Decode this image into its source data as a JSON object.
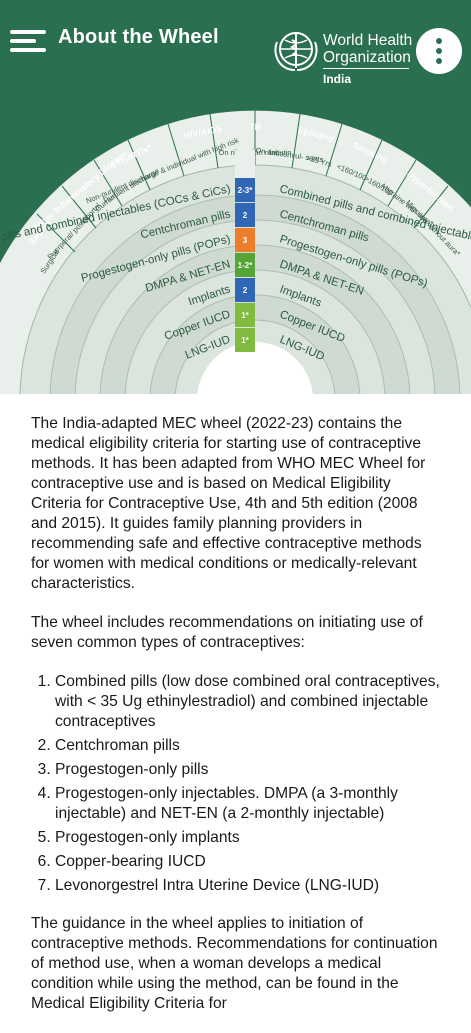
{
  "header": {
    "title": "About the Wheel",
    "org_line1": "World Health",
    "org_line2": "Organization",
    "org_country": "India",
    "menu_icon": "hamburger-menu-icon",
    "more_icon": "more-vert-icon",
    "background_color": "#2a7050"
  },
  "wheel": {
    "condition_headers": [
      "Sepsis",
      "Pelvic Inflammatory Disease",
      "STIs/RTIs*",
      "HIV/AIDS",
      "TB",
      "Epilepsy",
      "Smoking",
      "Hypertension"
    ],
    "sub_labels": [
      "Surgical",
      "Puerperal/ postabortal",
      "Current",
      "Purulent discharge",
      "Non-purulent discharge & individual with high risk",
      "On rifampicin rifabutin",
      "On anticonvul- sants",
      ">35 Yrs",
      "<160/100",
      ">160/100",
      "Migraine with aura*",
      "Migraine without aura*"
    ],
    "methods": [
      {
        "left": "Combined pills and combined injectables (COCs & CiCs)",
        "right": "Combined pills and combined injectables (COCs & CiCs)",
        "category": "2-3*",
        "color": "#2f66b5"
      },
      {
        "left": "Centchroman pills",
        "right": "Centchroman pills",
        "category": "2",
        "color": "#2f66b5"
      },
      {
        "left": "Progestogen-only pills (POPs)",
        "right": "Progestogen-only pills (POPs)",
        "category": "3",
        "color": "#ec7e2b"
      },
      {
        "left": "DMPA & NET-EN",
        "right": "DMPA & NET-EN",
        "category": "1-2*",
        "color": "#56a537"
      },
      {
        "left": "Implants",
        "right": "Implants",
        "category": "2",
        "color": "#2f66b5"
      },
      {
        "left": "Copper IUCD",
        "right": "Copper IUCD",
        "category": "1*",
        "color": "#7fbb3f"
      },
      {
        "left": "LNG-IUD",
        "right": "LNG-IUD",
        "category": "1*",
        "color": "#7fbb3f"
      }
    ]
  },
  "content": {
    "intro": "The India-adapted MEC wheel (2022-23) contains the medical eligibility criteria for starting use of contraceptive methods. It has been adapted from WHO MEC Wheel for contraceptive use and is based on Medical Eligibility Criteria for Contraceptive Use, 4th and 5th edition (2008 and 2015). It guides family planning providers in recommending safe and effective contraceptive methods for women with medical conditions or medically-relevant characteristics.",
    "list_intro": "The wheel includes recommendations on initiating use of seven common types of contraceptives:",
    "list": [
      "Combined pills (low dose combined oral contraceptives, with < 35 Ug ethinylestradiol) and combined injectable contraceptives",
      "Centchroman pills",
      "Progestogen-only pills",
      "Progestogen-only injectables. DMPA (a 3-monthly injectable) and NET-EN (a 2-monthly injectable)",
      "Progestogen-only implants",
      "Copper-bearing IUCD",
      "Levonorgestrel Intra Uterine Device (LNG-IUD)"
    ],
    "guidance": "The guidance in the wheel applies to initiation of contraceptive methods. Recommendations for continuation of method use, when a woman develops a medical condition while using the method, can be found in the Medical Eligibility Criteria for"
  }
}
